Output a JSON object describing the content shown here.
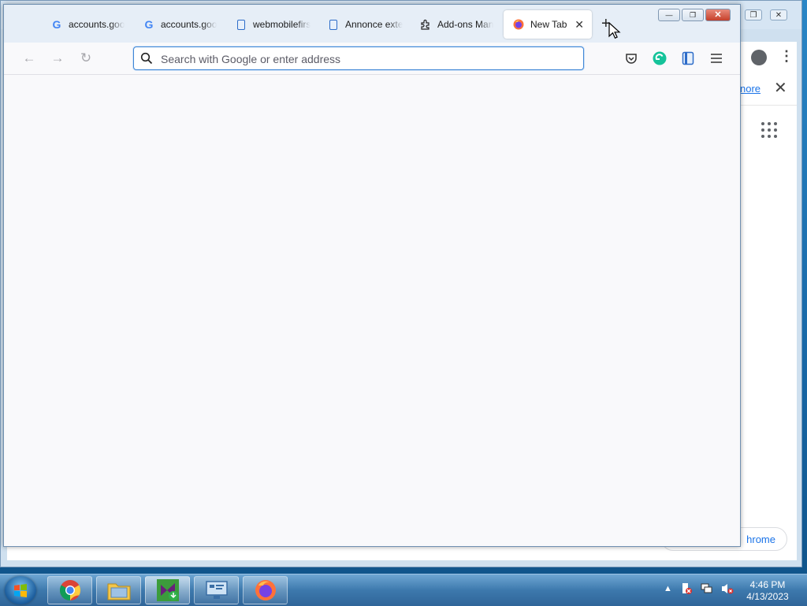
{
  "background_window": {
    "learn_more_text": "nore",
    "chrome_button_text": "hrome"
  },
  "firefox": {
    "tabs": [
      {
        "label": "accounts.goo",
        "icon": "google-icon"
      },
      {
        "label": "accounts.goo",
        "icon": "google-icon"
      },
      {
        "label": "webmobilefirs",
        "icon": "document-icon"
      },
      {
        "label": "Annonce exte",
        "icon": "document-icon"
      },
      {
        "label": "Add-ons Man",
        "icon": "puzzle-icon"
      },
      {
        "label": "New Tab",
        "icon": "firefox-icon",
        "active": true
      }
    ],
    "new_tab_symbol": "+",
    "url": {
      "value": "",
      "placeholder": "Search with Google or enter address"
    },
    "window_controls": {
      "minimize": "—",
      "restore": "❐",
      "close": "✕"
    }
  },
  "taskbar": {
    "apps": [
      "chrome-icon",
      "file-explorer-icon",
      "visual-studio-installer-icon",
      "remote-desktop-icon",
      "firefox-icon"
    ],
    "clock": {
      "time": "4:46 PM",
      "date": "4/13/2023"
    },
    "tray_expand": "▲"
  },
  "colors": {
    "url_focus": "#3f86d6",
    "content_bg": "#f9f9fb",
    "taskbar": "#3d79ad"
  }
}
